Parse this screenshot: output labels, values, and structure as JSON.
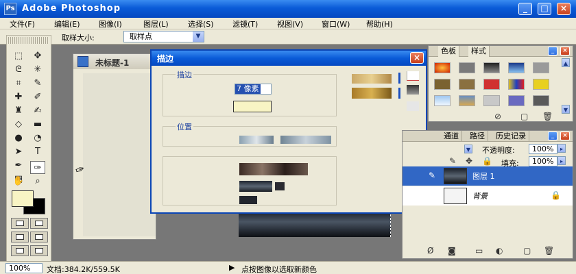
{
  "app": {
    "title": "Adobe Photoshop"
  },
  "menu": [
    {
      "label": "文件(F)"
    },
    {
      "label": "编辑(E)"
    },
    {
      "label": "图像(I)"
    },
    {
      "label": "图层(L)"
    },
    {
      "label": "选择(S)"
    },
    {
      "label": "滤镜(T)"
    },
    {
      "label": "视图(V)"
    },
    {
      "label": "窗口(W)"
    },
    {
      "label": "帮助(H)"
    }
  ],
  "options_bar": {
    "sample_size_label": "取样大小:",
    "sample_size_value": "取样点"
  },
  "document": {
    "title": "未标题-1"
  },
  "dialog": {
    "title": "描边",
    "stroke_group": "描边",
    "width_value": "7 像素",
    "stroke_color": "#f8f4c4",
    "location_group": "位置"
  },
  "panels": {
    "styles_tabs": [
      "色板",
      "样式"
    ],
    "layers_tabs": [
      "通道",
      "路径",
      "历史记录"
    ],
    "opacity_label": "不透明度:",
    "opacity_value": "100%",
    "fill_label": "填充:",
    "fill_value": "100%",
    "layers": [
      {
        "name": "图层 1",
        "selected": true
      },
      {
        "name": "背景",
        "selected": false
      }
    ]
  },
  "toolbox": {
    "foreground_color": "#f8f4c4",
    "background_color": "#000000"
  },
  "status": {
    "zoom": "100%",
    "doc_size": "文档:384.2K/559.5K",
    "message": "点按图像以选取新颜色"
  }
}
